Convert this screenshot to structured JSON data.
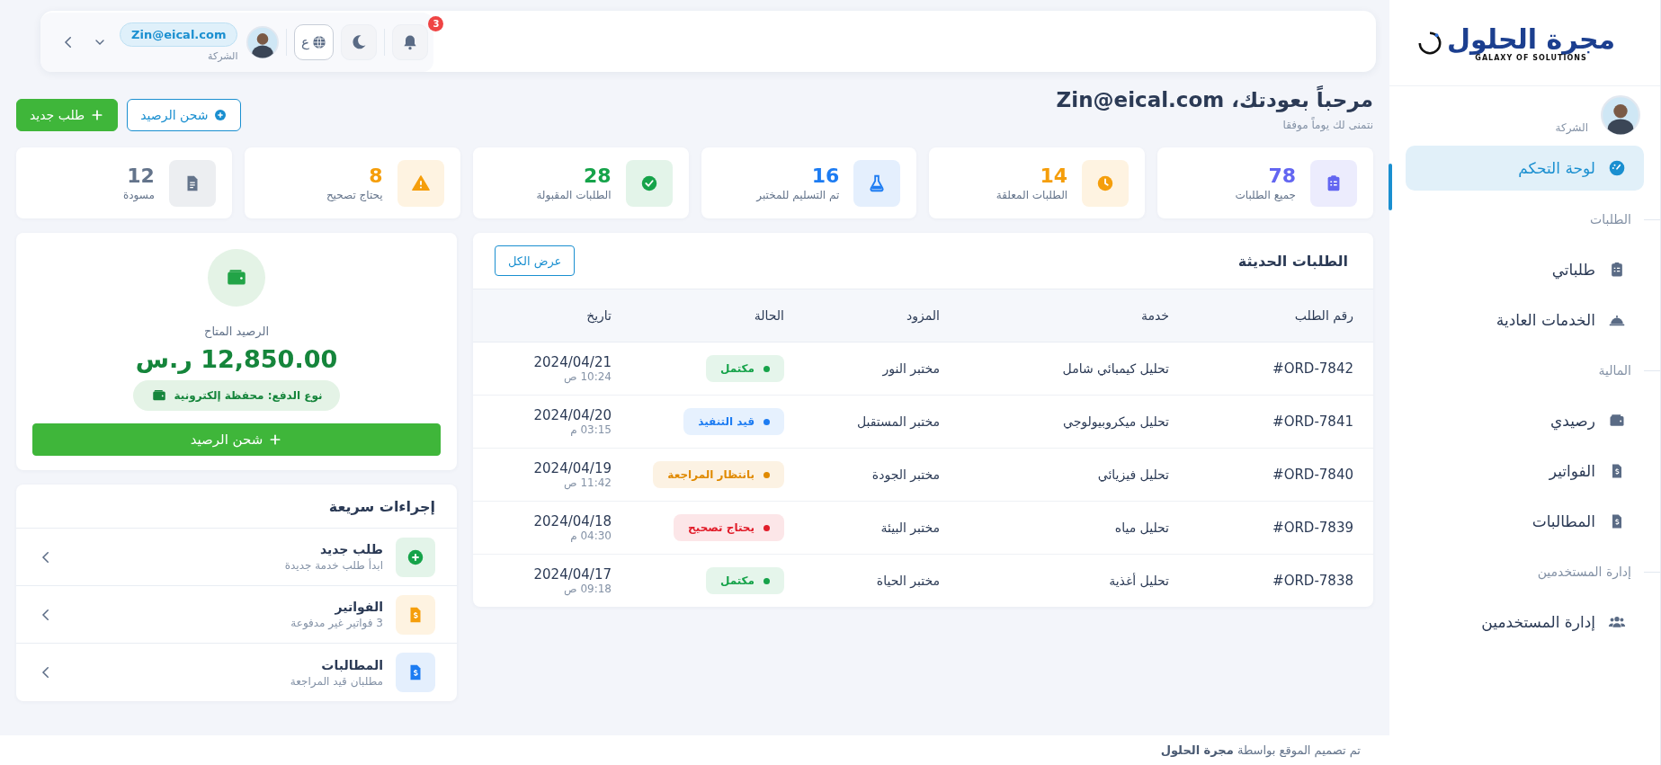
{
  "sidebar": {
    "logo": {
      "title": "مجرة الحلول",
      "tagline": "GALAXY OF SOLUTIONS"
    },
    "user": {
      "role": "الشركة"
    },
    "items": [
      {
        "kind": "item",
        "label": "لوحة التحكم",
        "selected": true
      },
      {
        "kind": "section",
        "label": "الطلبات"
      },
      {
        "kind": "item",
        "label": "طلباتي",
        "selected": false
      },
      {
        "kind": "item",
        "label": "الخدمات العادية",
        "selected": false
      },
      {
        "kind": "section",
        "label": "المالية"
      },
      {
        "kind": "item",
        "label": "رصيدي",
        "selected": false
      },
      {
        "kind": "item",
        "label": "الفواتير",
        "selected": false
      },
      {
        "kind": "item",
        "label": "المطالبات",
        "selected": false
      },
      {
        "kind": "section",
        "label": "إدارة المستخدمين"
      },
      {
        "kind": "item",
        "label": "إدارة المستخدمين",
        "selected": false
      }
    ]
  },
  "topbar": {
    "notifications": "3",
    "language": "ع",
    "user": {
      "email": "Zin@eical.com",
      "role": "الشركة"
    }
  },
  "header": {
    "title": "مرحباً بعودتك، Zin@eical.com",
    "subtitle": "نتمنى لك يوماً موفقا",
    "buttons": [
      {
        "kind": "outline",
        "label": "شحن الرصيد"
      },
      {
        "kind": "primary",
        "label": "طلب جديد"
      }
    ]
  },
  "stats": [
    {
      "value": "78",
      "label": "جميع الطلبات",
      "color": "#6366f1"
    },
    {
      "value": "14",
      "label": "الطلبات المعلقة",
      "color": "#f59e0b"
    },
    {
      "value": "16",
      "label": "تم التسليم للمختبر",
      "color": "#1d7cf2"
    },
    {
      "value": "28",
      "label": "الطلبات المقبولة",
      "color": "#16a34a"
    },
    {
      "value": "8",
      "label": "يحتاج تصحيح",
      "color": "#f59e0b"
    },
    {
      "value": "12",
      "label": "مسودة",
      "color": "#64748b"
    }
  ],
  "recent_orders": {
    "title": "الطلبات الحديثة",
    "view_all": "عرض الكل",
    "columns": [
      "رقم الطلب",
      "خدمة",
      "المزود",
      "الحالة",
      "تاريخ"
    ],
    "rows": [
      {
        "order": "#ORD-7842",
        "service": "تحليل كيمبائي شامل",
        "provider": "مختبر النور",
        "status": "مكتمل",
        "color": "#16a34a",
        "date": "2024/04/21",
        "time": "10:24 ص"
      },
      {
        "order": "#ORD-7841",
        "service": "تحليل ميكروبيولوجي",
        "provider": "مختبر المستقبل",
        "status": "قيد التنفيذ",
        "color": "#1d7cf2",
        "date": "2024/04/20",
        "time": "03:15 م"
      },
      {
        "order": "#ORD-7840",
        "service": "تحليل فيزيائي",
        "provider": "مختبر الجودة",
        "status": "بانتظار المراجعة",
        "color": "#e08a00",
        "date": "2024/04/19",
        "time": "11:42 ص"
      },
      {
        "order": "#ORD-7839",
        "service": "تحليل مياه",
        "provider": "مختبر البيئة",
        "status": "يحتاج تصحيح",
        "color": "#e11d2a",
        "date": "2024/04/18",
        "time": "04:30 م"
      },
      {
        "order": "#ORD-7838",
        "service": "تحليل أغذية",
        "provider": "مختبر الحياة",
        "status": "مكتمل",
        "color": "#16a34a",
        "date": "2024/04/17",
        "time": "09:18 ص"
      }
    ]
  },
  "balance": {
    "label": "الرصيد المتاح",
    "amount": "12,850.00 ر.س",
    "payment_type": "نوع الدفع: محفظة إلكترونية",
    "button": "شحن الرصيد"
  },
  "quick_actions": {
    "title": "إجراءات سريعة",
    "items": [
      {
        "title": "طلب جديد",
        "subtitle": "ابدأ طلب خدمة جديدة",
        "color": "#16a34a"
      },
      {
        "title": "الفواتير",
        "subtitle": "3 فواتير غير مدفوعة",
        "color": "#f59e0b"
      },
      {
        "title": "المطالبات",
        "subtitle": "مطلبان قيد المراجعة",
        "color": "#1d7cf2"
      }
    ]
  },
  "footer": {
    "text": "تم تصميم الموقع بواسطة **مجرة الحلول**"
  }
}
